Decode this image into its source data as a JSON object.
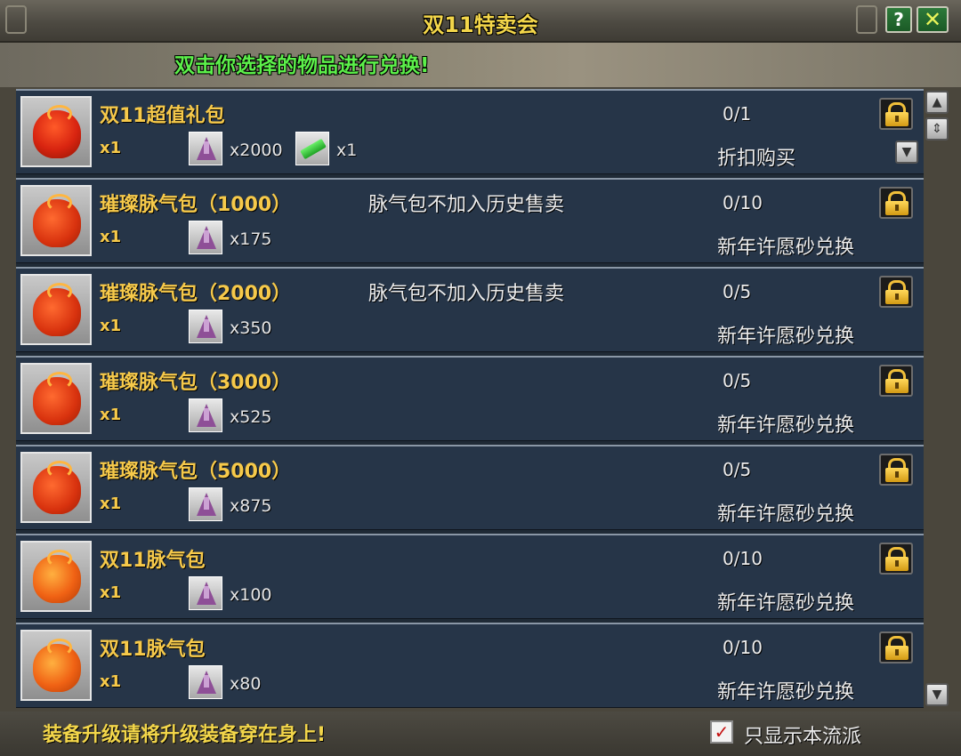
{
  "window": {
    "title": "双11特卖会",
    "help_label": "?",
    "close_label": "✕",
    "instruction": "双击你选择的物品进行兑换!"
  },
  "items": [
    {
      "name": "双11超值礼包",
      "qty": "x1",
      "costs": [
        {
          "icon": "crystal-icon",
          "amount": "x2000"
        },
        {
          "icon": "jade-ticket-icon",
          "amount": "x1"
        }
      ],
      "note": "",
      "limit": "0/1",
      "method": "折扣购买",
      "bag_style": "big"
    },
    {
      "name": "璀璨脉气包（1000）",
      "qty": "x1",
      "costs": [
        {
          "icon": "crystal-icon",
          "amount": "x175"
        }
      ],
      "note": "脉气包不加入历史售卖",
      "limit": "0/10",
      "method": "新年许愿砂兑换",
      "bag_style": "red"
    },
    {
      "name": "璀璨脉气包（2000）",
      "qty": "x1",
      "costs": [
        {
          "icon": "crystal-icon",
          "amount": "x350"
        }
      ],
      "note": "脉气包不加入历史售卖",
      "limit": "0/5",
      "method": "新年许愿砂兑换",
      "bag_style": "red"
    },
    {
      "name": "璀璨脉气包（3000）",
      "qty": "x1",
      "costs": [
        {
          "icon": "crystal-icon",
          "amount": "x525"
        }
      ],
      "note": "",
      "limit": "0/5",
      "method": "新年许愿砂兑换",
      "bag_style": "red"
    },
    {
      "name": "璀璨脉气包（5000）",
      "qty": "x1",
      "costs": [
        {
          "icon": "crystal-icon",
          "amount": "x875"
        }
      ],
      "note": "",
      "limit": "0/5",
      "method": "新年许愿砂兑换",
      "bag_style": "red"
    },
    {
      "name": "双11脉气包",
      "qty": "x1",
      "costs": [
        {
          "icon": "crystal-icon",
          "amount": "x100"
        }
      ],
      "note": "",
      "limit": "0/10",
      "method": "新年许愿砂兑换",
      "bag_style": "gold"
    },
    {
      "name": "双11脉气包",
      "qty": "x1",
      "costs": [
        {
          "icon": "crystal-icon",
          "amount": "x80"
        }
      ],
      "note": "",
      "limit": "0/10",
      "method": "新年许愿砂兑换",
      "bag_style": "gold"
    }
  ],
  "footer": {
    "note": "装备升级请将升级装备穿在身上!",
    "filter_label": "只显示本流派",
    "filter_checked": true,
    "filter_mark": "✓"
  },
  "colors": {
    "title": "#f3d64a",
    "instruction": "#5cf04a",
    "item_name": "#f6c94a",
    "row_bg": "#263548"
  }
}
